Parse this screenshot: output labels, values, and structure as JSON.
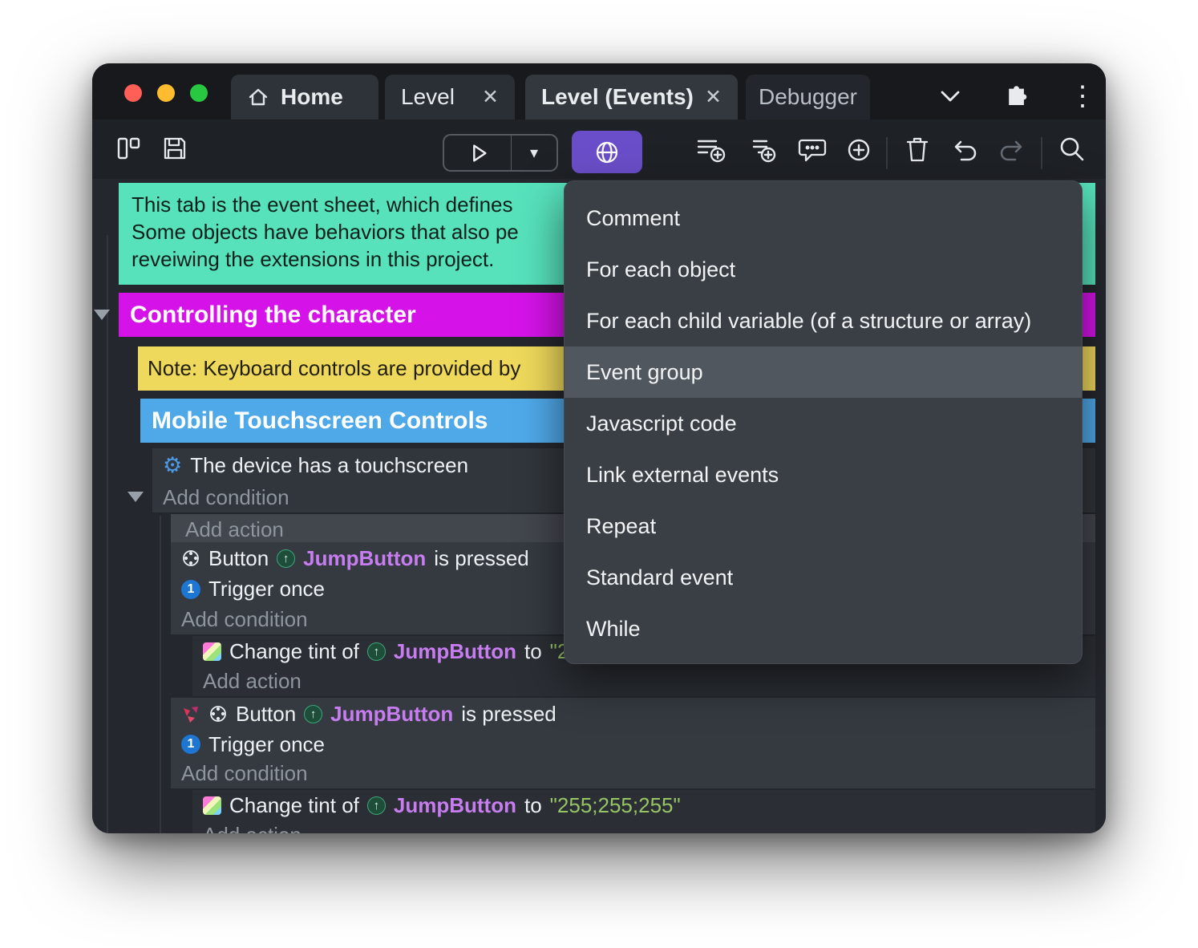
{
  "titlebar": {
    "tabs": [
      {
        "label": "Home"
      },
      {
        "label": "Level",
        "close": "✕"
      },
      {
        "label": "Level (Events)",
        "close": "✕"
      },
      {
        "label": "Debugger"
      }
    ],
    "icons": [
      "home-icon",
      "chevron-down-icon",
      "puzzle-icon",
      "kebab-menu-icon"
    ]
  },
  "toolbar": {
    "play_caret": "▾",
    "icons": [
      "panels-icon",
      "save-icon",
      "play-icon",
      "globe-icon",
      "add-event-icon",
      "add-subevent-icon",
      "comment-bubble-icon",
      "circle-plus-icon",
      "trash-icon",
      "undo-icon",
      "redo-icon",
      "search-icon"
    ]
  },
  "sheet": {
    "comment": {
      "line1": "This tab is the event sheet, which defines",
      "line2": "Some objects have behaviors that also pe",
      "line3": "reveiwing the extensions in this project."
    },
    "group_controlling": "Controlling the character",
    "note_keyboard": "Note: Keyboard controls are provided by",
    "group_mobile": "Mobile Touchscreen Controls",
    "touchscreen_condition": "The device has a touchscreen",
    "add_condition": "Add condition",
    "add_action": "Add action",
    "button_word": "Button",
    "object_name": "JumpButton",
    "is_pressed": "is pressed",
    "trigger_once": "Trigger once",
    "change_tint_of": "Change tint of",
    "to_word": "to",
    "tint_value": "\"255;255;255\""
  },
  "context_menu": {
    "items": [
      "Comment",
      "For each object",
      "For each child variable (of a structure or array)",
      "Event group",
      "Javascript code",
      "Link external events",
      "Repeat",
      "Standard event",
      "While"
    ],
    "highlighted": "Event group"
  },
  "colors": {
    "comment_bg": "#57e2bc",
    "group_controlling_bg": "#d513e9",
    "note_bg": "#efd95c",
    "group_mobile_bg": "#4fa9e9",
    "accent_button": "#6a4ec9",
    "object_text": "#c77df0",
    "string_text": "#97c464",
    "menu_highlight": "#51575f"
  }
}
